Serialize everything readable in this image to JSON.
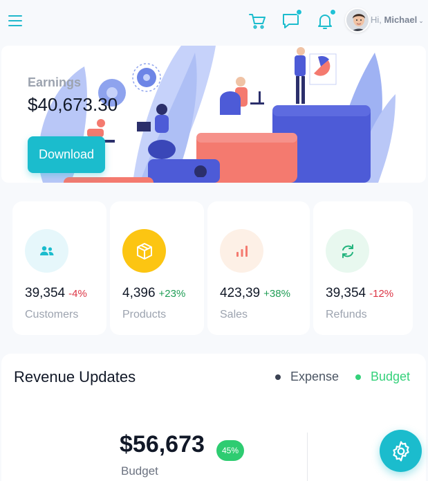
{
  "header": {
    "greeting": "Hi,",
    "user_name": "Michael",
    "icons": [
      "menu-icon",
      "cart-icon",
      "chat-icon",
      "bell-icon",
      "avatar"
    ],
    "accent": "#1bbccd"
  },
  "earnings": {
    "label": "Earnings",
    "value": "$40,673.30",
    "button_label": "Download"
  },
  "stats": [
    {
      "value": "39,354",
      "change": "-4%",
      "label": "Customers",
      "icon": "users-icon",
      "circle_color": "#e6f7fb",
      "icon_color": "#1bbccd"
    },
    {
      "value": "4,396",
      "change": "+23%",
      "label": "Products",
      "icon": "box-icon",
      "circle_color": "#fcc512",
      "icon_color": "#ffffff"
    },
    {
      "value": "423,39",
      "change": "+38%",
      "label": "Sales",
      "icon": "bar-chart-icon",
      "circle_color": "#fdf0e6",
      "icon_color": "#f47a6f"
    },
    {
      "value": "39,354",
      "change": "-12%",
      "label": "Refunds",
      "icon": "refresh-icon",
      "circle_color": "#e8f8ef",
      "icon_color": "#24b47e"
    }
  ],
  "revenue": {
    "title": "Revenue Updates",
    "legend": [
      {
        "name": "Expense",
        "color": "#3b4252"
      },
      {
        "name": "Budget",
        "color": "#34d17a"
      }
    ],
    "value": "$56,673",
    "badge": "45%",
    "sub_label": "Budget"
  }
}
